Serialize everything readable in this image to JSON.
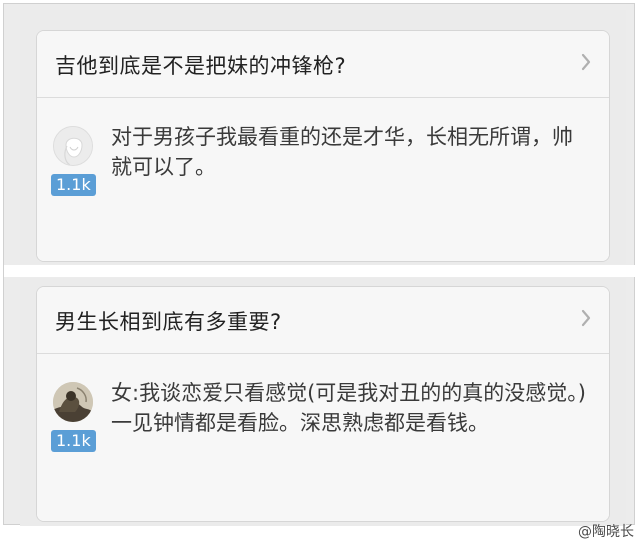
{
  "cards": [
    {
      "question": "吉他到底是不是把妹的冲锋枪?",
      "votes": "1.1k",
      "answer": "对于男孩子我最看重的还是才华，长相无所谓，帅就可以了。"
    },
    {
      "question": "男生长相到底有多重要?",
      "votes": "1.1k",
      "answer": "女:我谈恋爱只看感觉(可是我对丑的的真的没感觉。)一见钟情都是看脸。深思熟虑都是看钱。"
    }
  ],
  "watermark": "@陶晓长",
  "icons": {
    "chevron": "chevron-right-icon",
    "avatar_1": "default-avatar-icon",
    "avatar_2": "user-photo-avatar"
  },
  "colors": {
    "vote_badge": "#5b9ed6",
    "card_bg": "#f7f7f7",
    "panel_bg": "#ebebeb"
  }
}
